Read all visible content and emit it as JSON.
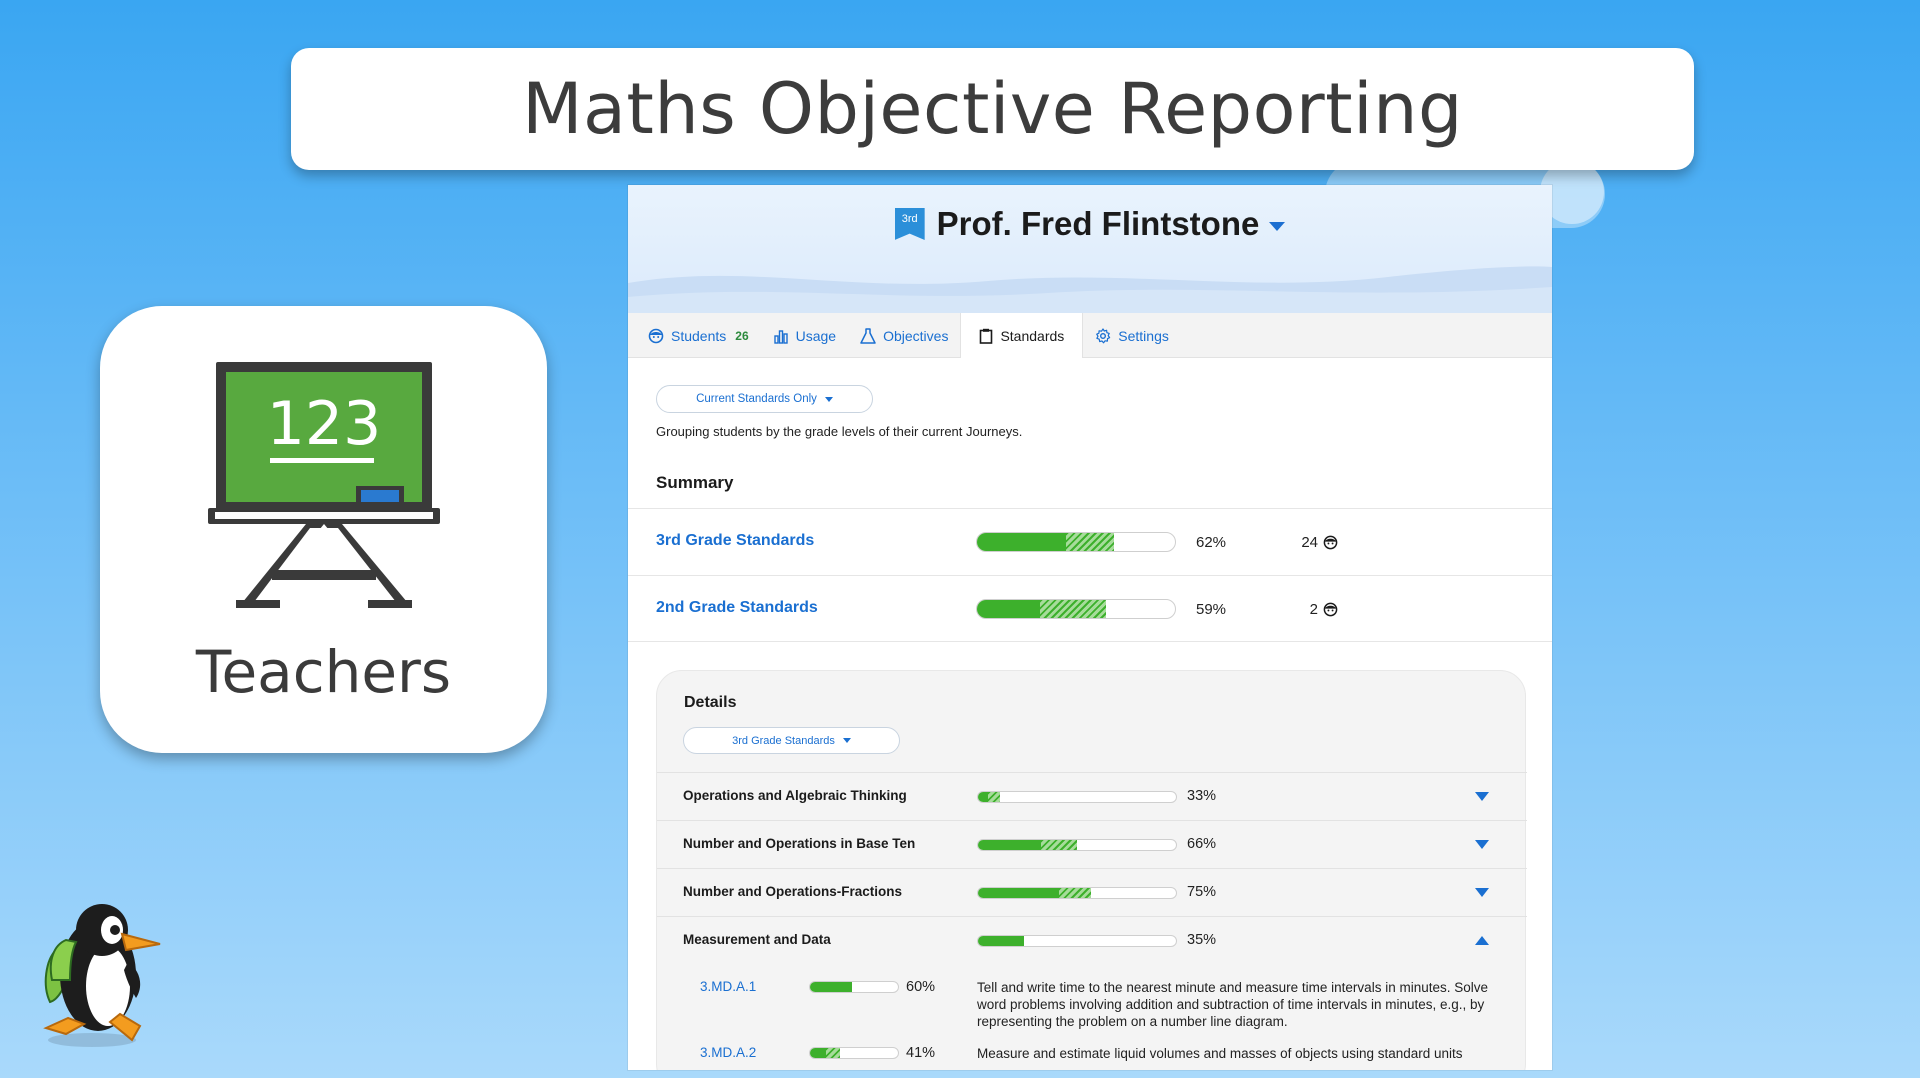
{
  "banner": {
    "title": "Maths Objective Reporting"
  },
  "teacher_card": {
    "board_number": "123",
    "label": "Teachers"
  },
  "app": {
    "grade_badge": "3rd",
    "teacher_name": "Prof. Fred Flintstone",
    "tabs": [
      {
        "label": "Students",
        "count": "26",
        "icon": "student-face-icon"
      },
      {
        "label": "Usage",
        "icon": "bar-chart-icon"
      },
      {
        "label": "Objectives",
        "icon": "flask-icon"
      },
      {
        "label": "Standards",
        "icon": "clipboard-icon",
        "active": true
      },
      {
        "label": "Settings",
        "icon": "gear-icon"
      }
    ],
    "filter": {
      "selected": "Current Standards Only"
    },
    "description": "Grouping students by the grade levels of their current Journeys.",
    "summary": {
      "title": "Summary",
      "rows": [
        {
          "name": "3rd Grade Standards",
          "solid": 0.45,
          "hatched": 0.24,
          "percent": "62%",
          "students": "24"
        },
        {
          "name": "2nd Grade Standards",
          "solid": 0.32,
          "hatched": 0.33,
          "percent": "59%",
          "students": "2"
        }
      ]
    },
    "details": {
      "title": "Details",
      "filter": "3rd Grade Standards",
      "rows": [
        {
          "name": "Operations and Algebraic Thinking",
          "solid": 0.05,
          "hatched": 0.06,
          "percent": "33%",
          "expanded": false
        },
        {
          "name": "Number and Operations in Base Ten",
          "solid": 0.32,
          "hatched": 0.18,
          "percent": "66%",
          "expanded": false
        },
        {
          "name": "Number and Operations-Fractions",
          "solid": 0.41,
          "hatched": 0.16,
          "percent": "75%",
          "expanded": false
        },
        {
          "name": "Measurement and Data",
          "solid": 0.23,
          "hatched": 0.0,
          "percent": "35%",
          "expanded": true
        }
      ],
      "standards": [
        {
          "code": "3.MD.A.1",
          "solid": 0.48,
          "hatched": 0.0,
          "percent": "60%",
          "text": "Tell and write time to the nearest minute and measure time intervals in minutes. Solve word problems involving addition and subtraction of time intervals in minutes, e.g., by representing the problem on a number line diagram."
        },
        {
          "code": "3.MD.A.2",
          "solid": 0.18,
          "hatched": 0.16,
          "percent": "41%",
          "text": "Measure and estimate liquid volumes and masses of objects using standard units"
        }
      ]
    }
  },
  "colors": {
    "progress": "#3db02c",
    "link": "#1a6fd1",
    "background": "#3aa6f2"
  }
}
